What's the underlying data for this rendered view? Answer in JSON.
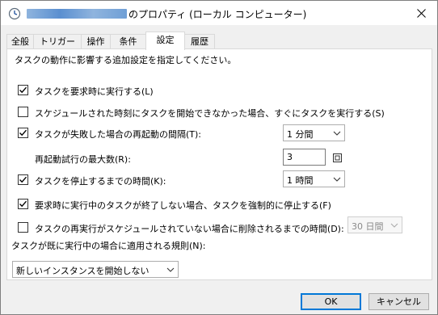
{
  "window": {
    "title_suffix": "のプロパティ (ローカル コンピューター)"
  },
  "tabs": [
    {
      "label": "全般"
    },
    {
      "label": "トリガー"
    },
    {
      "label": "操作"
    },
    {
      "label": "条件"
    },
    {
      "label": "設定"
    },
    {
      "label": "履歴"
    }
  ],
  "settings": {
    "intro": "タスクの動作に影響する追加設定を指定してください。",
    "allow_on_demand": {
      "label": "タスクを要求時に実行する(L)",
      "checked": true
    },
    "run_asap_missed": {
      "label": "スケジュールされた時刻にタスクを開始できなかった場合、すぐにタスクを実行する(S)",
      "checked": false
    },
    "restart_on_failure": {
      "label": "タスクが失敗した場合の再起動の間隔(T):",
      "checked": true,
      "value": "1 分間"
    },
    "restart_attempts": {
      "label": "再起動試行の最大数(R):",
      "value": "3"
    },
    "stop_if_runs_longer": {
      "label": "タスクを停止するまでの時間(K):",
      "checked": true,
      "value": "1 時間"
    },
    "force_stop": {
      "label": "要求時に実行中のタスクが終了しない場合、タスクを強制的に停止する(F)",
      "checked": true
    },
    "delete_if_not_scheduled": {
      "label": "タスクの再実行がスケジュールされていない場合に削除されるまでの時間(D):",
      "checked": false,
      "value": "30 日間"
    },
    "rule_label": "タスクが既に実行中の場合に適用される規則(N):",
    "rule_value": "新しいインスタンスを開始しない"
  },
  "buttons": {
    "ok": "OK",
    "cancel": "キャンセル"
  },
  "colors": {
    "accent": "#0078d7",
    "panel_bg": "#ffffff",
    "window_bg": "#f0f0f0"
  }
}
